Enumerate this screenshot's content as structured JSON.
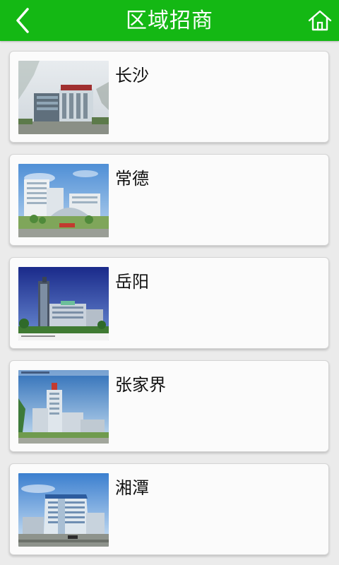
{
  "header": {
    "title": "区域招商",
    "back_icon": "chevron-left-icon",
    "home_icon": "home-icon",
    "color": "#14b814"
  },
  "regions": [
    {
      "name": "长沙",
      "image": "building-photo-changsha"
    },
    {
      "name": "常德",
      "image": "building-photo-changde"
    },
    {
      "name": "岳阳",
      "image": "building-photo-yueyang"
    },
    {
      "name": "张家界",
      "image": "building-photo-zhangjiajie"
    },
    {
      "name": "湘潭",
      "image": "building-photo-xiangtan"
    }
  ]
}
